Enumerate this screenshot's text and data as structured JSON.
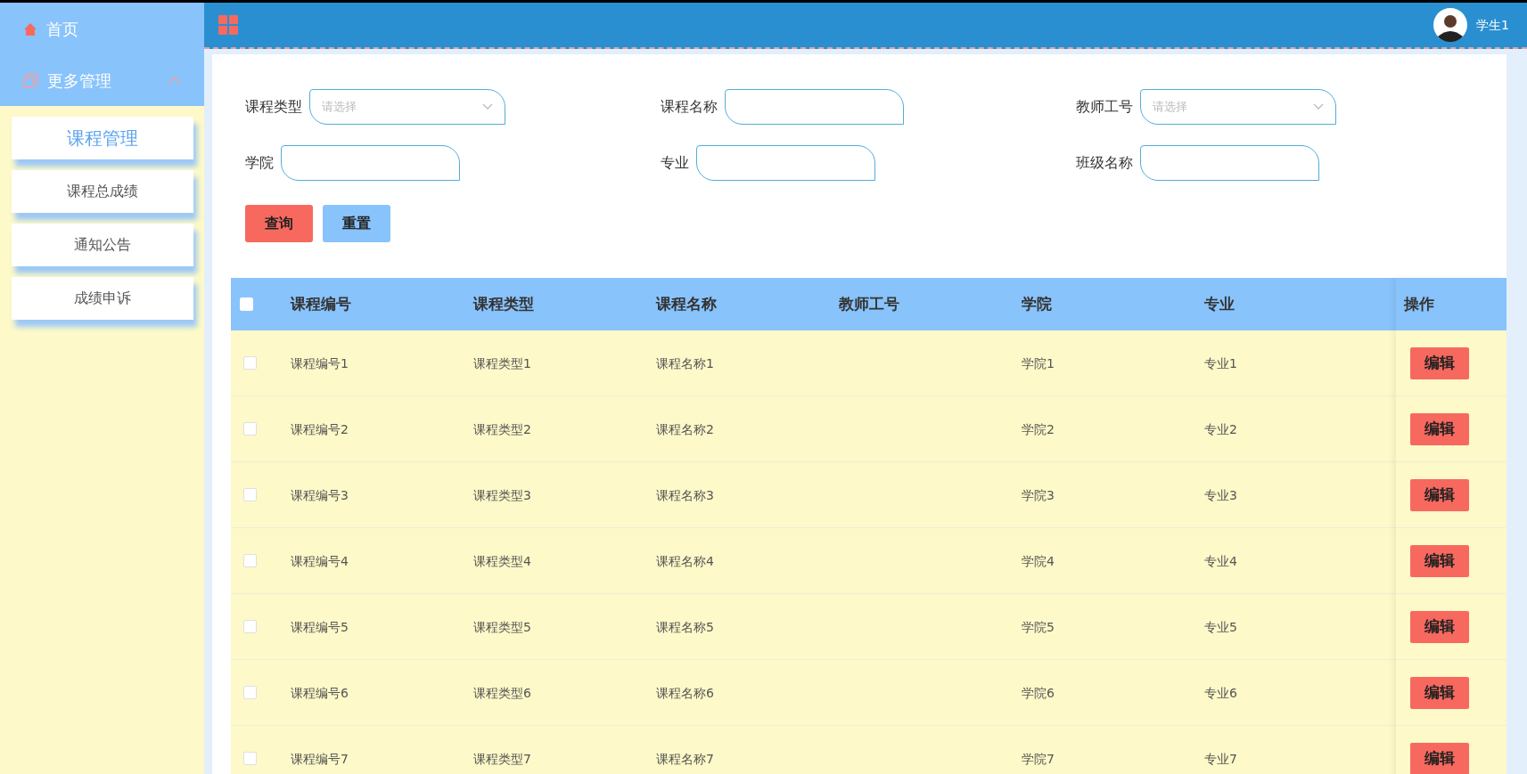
{
  "sidebar": {
    "items": [
      {
        "label": "首页",
        "kind": "link"
      },
      {
        "label": "更多管理",
        "kind": "group",
        "expanded": true,
        "children": [
          {
            "label": "课程管理",
            "selected": true
          },
          {
            "label": "课程总成绩",
            "selected": false
          },
          {
            "label": "通知公告",
            "selected": false
          },
          {
            "label": "成绩申诉",
            "selected": false
          }
        ]
      }
    ]
  },
  "header": {
    "user": "学生1"
  },
  "filters": [
    {
      "label": "课程类型",
      "kind": "select",
      "placeholder": "请选择"
    },
    {
      "label": "课程名称",
      "kind": "input"
    },
    {
      "label": "教师工号",
      "kind": "select",
      "placeholder": "请选择"
    },
    {
      "label": "学院",
      "kind": "input"
    },
    {
      "label": "专业",
      "kind": "input"
    },
    {
      "label": "班级名称",
      "kind": "input"
    }
  ],
  "buttons": [
    {
      "label": "查询",
      "kind": "primary"
    },
    {
      "label": "重置",
      "kind": "secondary"
    }
  ],
  "table": {
    "all_checked": false,
    "columns": [
      "课程编号",
      "课程类型",
      "课程名称",
      "教师工号",
      "学院",
      "专业"
    ],
    "action_column": "操作",
    "rows": [
      {
        "checked": false,
        "cells": [
          "课程编号1",
          "课程类型1",
          "课程名称1",
          "",
          "学院1",
          "专业1"
        ],
        "action": "编辑"
      },
      {
        "checked": false,
        "cells": [
          "课程编号2",
          "课程类型2",
          "课程名称2",
          "",
          "学院2",
          "专业2"
        ],
        "action": "编辑"
      },
      {
        "checked": false,
        "cells": [
          "课程编号3",
          "课程类型3",
          "课程名称3",
          "",
          "学院3",
          "专业3"
        ],
        "action": "编辑"
      },
      {
        "checked": false,
        "cells": [
          "课程编号4",
          "课程类型4",
          "课程名称4",
          "",
          "学院4",
          "专业4"
        ],
        "action": "编辑"
      },
      {
        "checked": false,
        "cells": [
          "课程编号5",
          "课程类型5",
          "课程名称5",
          "",
          "学院5",
          "专业5"
        ],
        "action": "编辑"
      },
      {
        "checked": false,
        "cells": [
          "课程编号6",
          "课程类型6",
          "课程名称6",
          "",
          "学院6",
          "专业6"
        ],
        "action": "编辑"
      },
      {
        "checked": false,
        "cells": [
          "课程编号7",
          "课程类型7",
          "课程名称7",
          "",
          "学院7",
          "专业7"
        ],
        "action": "编辑"
      }
    ]
  }
}
